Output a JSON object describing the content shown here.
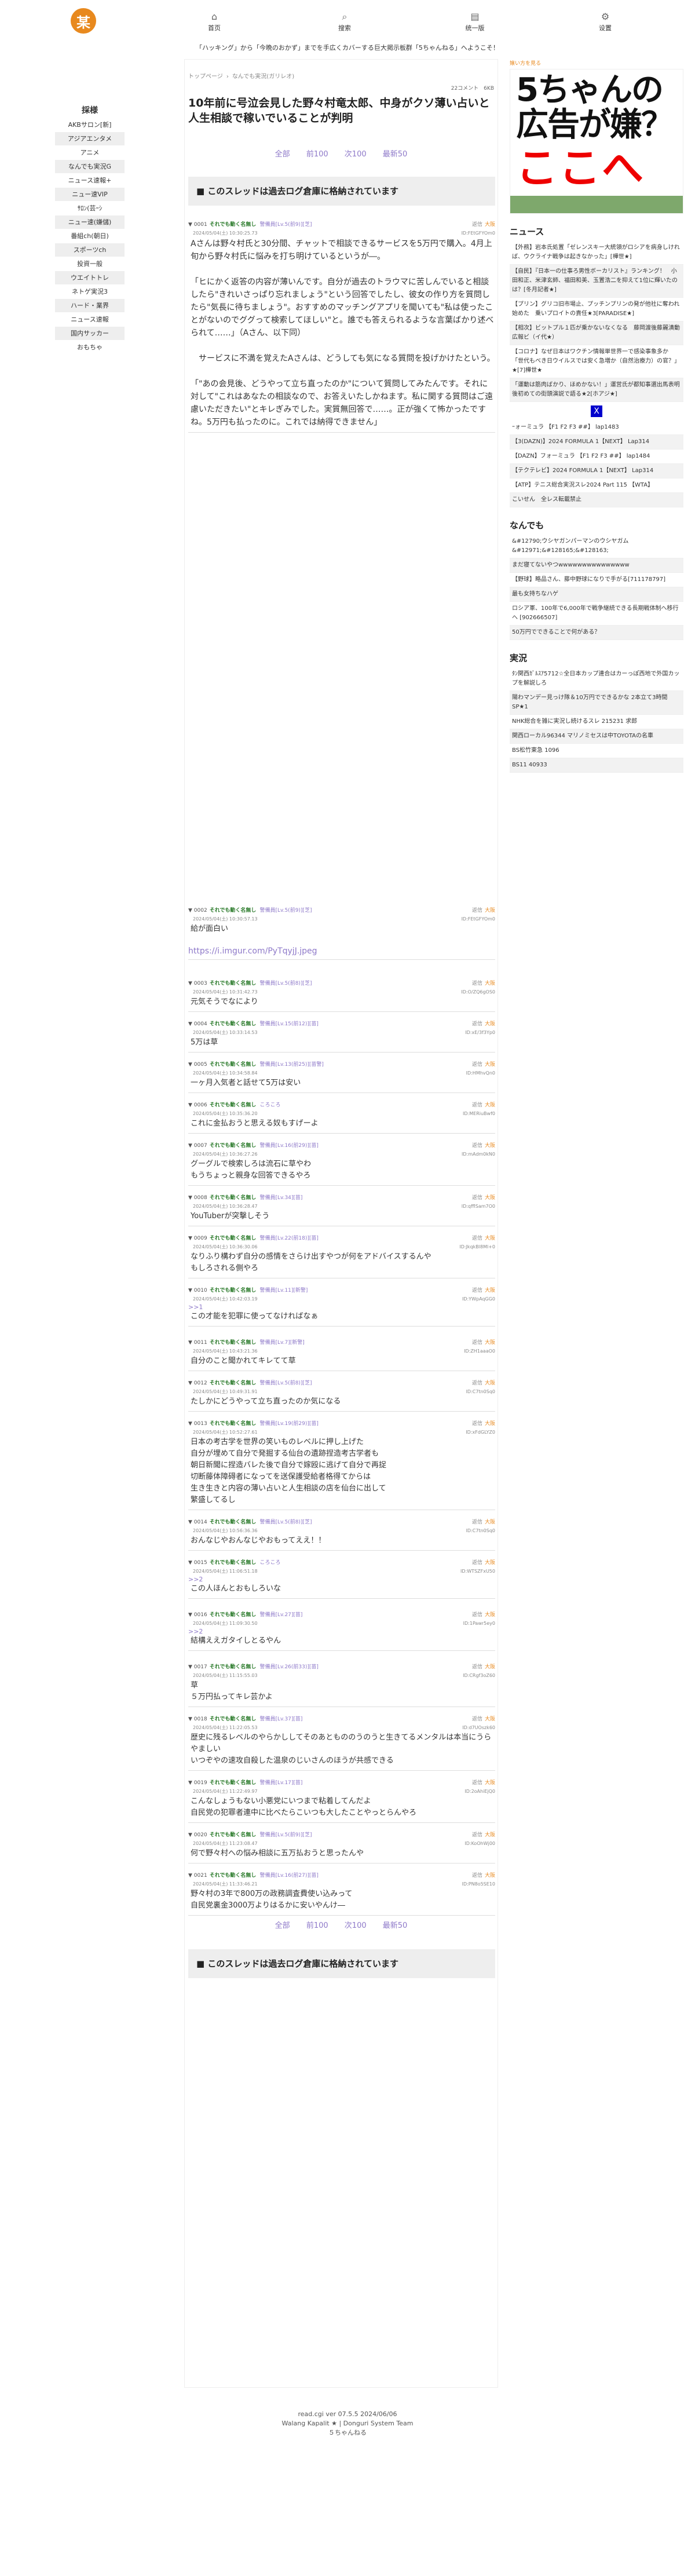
{
  "nav": {
    "logo": "某",
    "items": [
      {
        "label": "首页",
        "icon": "⌂"
      },
      {
        "label": "搜索",
        "icon": "⌕"
      },
      {
        "label": "统一版",
        "icon": "▤"
      },
      {
        "label": "设置",
        "icon": "⚙"
      }
    ]
  },
  "welcome": "「ハッキング」から「今晩のおかず」までを手広くカバーする巨大掲示板群「5ちゃんねる」へようこそ！",
  "sidebar": {
    "title": "採様",
    "items": [
      "AKBサロン[新]",
      "アジアエンタメ",
      "アニメ",
      "なんでも実況G",
      "ニュース速報+",
      "ニュー速VIP",
      "ｻﾛﾝ(芸ｰｼ",
      "ニュー速(嫌儲)",
      "番組ch(朝日)",
      "スポーツch",
      "投資一般",
      "ウエイトトレ",
      "ネトゲ実況3",
      "ハード・業界",
      "ニュース速報",
      "国内サッカー",
      "おもちゃ"
    ]
  },
  "thread": {
    "breadcrumb_home": "トップページ",
    "breadcrumb_sep": "›",
    "breadcrumb_board": "なんでも実況(ガリレオ)",
    "counts": "22コメント　6KB",
    "title": "10年前に号泣会見した野々村竜太郎、中身がクソ薄い占いと人生相談で稼いでいることが判明",
    "pager": [
      "全部",
      "前100",
      "次100",
      "最新50"
    ],
    "archive_notice": "■ このスレッドは過去ログ倉庫に格納されています"
  },
  "posts": [
    {
      "num": "0001",
      "name": "それでも動く名無し",
      "rank": "警備員[Lv.5(前9)][芝]",
      "date": "2024/05/04(土) 10:30:25.73",
      "id": "ID:FEtGFYOm0",
      "os": "大阪",
      "body": "Aさんは野々村氏と30分間、チャットで相談できるサービスを5万円で購入。4月上旬から野々村氏に悩みを打ち明けているというが―。\n\n「ヒにかく返答の内容が薄いんです。自分が過去のトラウマに苦しんでいると相談したら\"きれいさっぱり忘れましょう\"という回答でしたし、彼女の作り方を質問したら\"気長に待ちましょう\"。おすすめのマッチングアプリを聞いても\"私は使ったことがないのでググって検索してほしい\"と。誰でも答えられるような言葉ばかり述べられて……」（Aさん、以下同）\n\n　サービスに不満を覚えたAさんは、どうしても気になる質問を投げかけたという。\n\n「\"あの会見後、どうやって立ち直ったのか\"について質問してみたんです。それに対して\"これはあなたの相談なので、お答えいたしかねます。私に関する質問はご遠慮いただきたい\"とキレぎみでした。実質無回答で……。正が強くて怖かったですね。5万円も払ったのに。これでは納得できません」",
      "big": true
    },
    {
      "num": "0002",
      "name": "それでも動く名無し",
      "rank": "警備員[Lv.5(前9)][芝]",
      "date": "2024/05/04(土) 10:30:57.13",
      "id": "ID:FEtGFYOm0",
      "os": "大阪",
      "body": "給が面白い",
      "link": "https://i.imgur.com/PyTqyjJ.jpeg"
    },
    {
      "num": "0003",
      "name": "それでも動く名無し",
      "rank": "警備員[Lv.5(前8)][芝]",
      "date": "2024/05/04(土) 10:31:42.73",
      "id": "ID:O/ZQ6gOS0",
      "os": "大阪",
      "body": "元気そうでなにより"
    },
    {
      "num": "0004",
      "name": "それでも動く名無し",
      "rank": "警備員[Lv.15(前12)][苗]",
      "date": "2024/05/04(土) 10:33:14.53",
      "id": "ID:xE/3f3Yp0",
      "os": "大阪",
      "body": "5万は草"
    },
    {
      "num": "0005",
      "name": "それでも動く名無し",
      "rank": "警備員[Lv.13(前25)][苗警]",
      "date": "2024/05/04(土) 10:34:58.84",
      "id": "ID:HMhvQn0",
      "os": "大阪",
      "body": "一ヶ月入気者と話せて5万は安い"
    },
    {
      "num": "0006",
      "name": "それでも動く名無し",
      "rank": "ころころ",
      "date": "2024/05/04(土) 10:35:36.20",
      "id": "ID:MERiuBwf0",
      "os": "大阪",
      "body": "これに金払おうと思える奴もすげーよ"
    },
    {
      "num": "0007",
      "name": "それでも動く名無し",
      "rank": "警備員[Lv.16(前29)][苗]",
      "date": "2024/05/04(土) 10:36:27.26",
      "id": "ID:mAdm0kN0",
      "os": "大阪",
      "body": "グーグルで検索しろは流石に草やわ\nもうちょっと親身な回答できるやろ"
    },
    {
      "num": "0008",
      "name": "それでも動く名無し",
      "rank": "警備員[Lv.34][苗]",
      "date": "2024/05/04(土) 10:36:28.47",
      "id": "ID:qfflSam7O0",
      "os": "大阪",
      "body": "YouTuberが突撃しそう"
    },
    {
      "num": "0009",
      "name": "それでも動く名無し",
      "rank": "警備員[Lv.22(前18)][苗]",
      "date": "2024/05/04(土) 10:36:30.06",
      "id": "ID:JkqkBl8Ml+0",
      "os": "大阪",
      "body": "なりふり構わず自分の感情をさらけ出すやつが何をアドバイスするんや\nもしろされる側やろ"
    },
    {
      "num": "0010",
      "name": "それでも動く名無し",
      "rank": "警備員[Lv.11][新警]",
      "date": "2024/05/04(土) 10:42:03.19",
      "id": "ID:YWpAqGG0",
      "os": "大阪",
      "anchor": ">>1",
      "body": "この才能を犯罪に使ってなければなぁ"
    },
    {
      "num": "0011",
      "name": "それでも動く名無し",
      "rank": "警備員[Lv.7][新警]",
      "date": "2024/05/04(土) 10:43:21.36",
      "id": "ID:ZH1aaaO0",
      "os": "大阪",
      "body": "自分のこと聞かれてキレてて草"
    },
    {
      "num": "0012",
      "name": "それでも動く名無し",
      "rank": "警備員[Lv.5(前8)][芝]",
      "date": "2024/05/04(土) 10:49:31.91",
      "id": "ID:C7tn0Sq0",
      "os": "大阪",
      "body": "たしかにどうやって立ち直ったのか気になる"
    },
    {
      "num": "0013",
      "name": "それでも動く名無し",
      "rank": "警備員[Lv.19(前29)][苗]",
      "date": "2024/05/04(土) 10:52:27.61",
      "id": "ID:xFdGLYZ0",
      "os": "大阪",
      "body": "日本の考古学を世界の笑いものレベルに押し上げた\n自分が埋めて自分で発掘する仙台の遺跡捏造考古学者も\n朝日新聞に捏造バレた後で自分で嫁殴に逃げて自分で再捉\n切断藤体障碍者になってを送保護受給者格得てからは\n生き生きと内容の薄い占いと人生相談の店を仙台に出して\n繁盛してるし"
    },
    {
      "num": "0014",
      "name": "それでも動く名無し",
      "rank": "警備員[Lv.5(前8)][芝]",
      "date": "2024/05/04(土) 10:56:36.36",
      "id": "ID:C7tn0Sq0",
      "os": "大阪",
      "body": "おんなじやおんなじやおもってええ！！"
    },
    {
      "num": "0015",
      "name": "それでも動く名無し",
      "rank": "ころころ",
      "date": "2024/05/04(土) 11:06:51.18",
      "id": "ID:WTSZFxU50",
      "os": "大阪",
      "anchor": ">>2",
      "body": "この人ほんとおもしろいな"
    },
    {
      "num": "0016",
      "name": "それでも動く名無し",
      "rank": "警備員[Lv.27][苗]",
      "date": "2024/05/04(土) 11:09:30.50",
      "id": "ID:1Pawr5ey0",
      "os": "大阪",
      "anchor": ">>2",
      "body": "結構ええガタイしとるやん"
    },
    {
      "num": "0017",
      "name": "それでも動く名無し",
      "rank": "警備員[Lv.26(前33)][苗]",
      "date": "2024/05/04(土) 11:15:55.03",
      "id": "ID:CRgf3oZ60",
      "os": "大阪",
      "body": "草\n５万円払ってキレ芸かよ"
    },
    {
      "num": "0018",
      "name": "それでも動く名無し",
      "rank": "警備員[Lv.37][苗]",
      "date": "2024/05/04(土) 11:22:05.53",
      "id": "ID:d7UOszk60",
      "os": "大阪",
      "body": "歴史に残るレベルのやらかししてそのあともののうのうと生きてるメンタルは本当にうらやましい\nいつぞやの速攻自殺した温泉のじいさんのほうが共感できる"
    },
    {
      "num": "0019",
      "name": "それでも動く名無し",
      "rank": "警備員[Lv.17][苗]",
      "date": "2024/05/04(土) 11:22:49.97",
      "id": "ID:2oAhiEjQ0",
      "os": "大阪",
      "body": "こんなしょうもない小悪党にいつまで粘着してんだよ\n自民党の犯罪者連中に比べたらこいつも大したことやっとらんやろ"
    },
    {
      "num": "0020",
      "name": "それでも動く名無し",
      "rank": "警備員[Lv.5(前9)][芝]",
      "date": "2024/05/04(土) 11:23:08.47",
      "id": "ID:KoOhWj00",
      "os": "大阪",
      "body": "何で野々村への悩み相談に五万払おうと思ったんや"
    },
    {
      "num": "0021",
      "name": "それでも動く名無し",
      "rank": "警備員[Lv.16(前27)][苗]",
      "date": "2024/05/04(土) 11:33:46.21",
      "id": "ID:PN8o5SE10",
      "os": "大阪",
      "body": "野々村の3年で800万の政務調査費使い込みって\n自民党裏金3000万よりはるかに安いやんけ―"
    }
  ],
  "right": {
    "ad_label": "嬢い方を見る",
    "ad_line1": "5ちゃんの",
    "ad_line2": "広告が嫌？",
    "ad_line3": "ここへ",
    "news_title": "ニュース",
    "news": [
      "【外務】岩本氏処置「ゼレンスキー大統領がロシアを病身しければ、ウクライナ戦争は起きなかった」[樺世★]",
      "【自民】『日本一の仕事ろ男性ボーカリスト』ランキング！　小田和正、米津玄師、福田和美、玉置浩二を抑えて1位に輝いたのは？[冬月記者★]",
      "【プリン】グリコ旧市場止、プッチンプリンの発が他社に奪われ始めた　乗いプロイトの責任★3[PARADISE★]",
      "【相次】ビットプル１匹が乗かないなくなる　藤岡渡後藤麗潰動広報ビ（イ代★）",
      "【コロナ】なぜ日本はワクチン情報単世界一で感染事象多か　「世代もべき日ウイルスでは安く急増か（自然治療力）の官？」★[7]樺世★",
      "「運動は筋肉ばかり、ほめかない！」運営氏が都知事選出馬表明後初めての街頭演説で語る★2[ホアジ★]"
    ],
    "x_label": "X",
    "f1": [
      "ｰォーミュラ 【F1 F2 F3 ##】 lap1483",
      "【3(DAZN)】2024 FORMULA 1【NEXT】 Lap314",
      "【DAZN】フォーミュラ 【F1 F2 F3 ##】 lap1484",
      "【テクテレビ】2024 FORMULA 1【NEXT】 Lap314",
      "【ATP】テニス総合実況スレ2024 Part 115 【WTA】",
      "こいせん　全レス転載禁止"
    ],
    "nandemo_title": "なんでも",
    "nandemo": [
      "&#12790;ウシヤガンパーマンのウシヤガム&#12971;&#128165;&#128163;",
      "まだ寝てないやつwwwwwwwwwwwwwww",
      "【野球】略品さん、藤中野球になりで手がる[711178797]",
      "最も女持ちなハゲ",
      "ロシア軍、100年で6,000年で戦争継続できる長期戦体制へ移行へ [902666507]",
      "50万円でできることで何がある？"
    ],
    "jikkyo_title": "実況",
    "jikkyo": [
      "ﾀﾝ関西ｶﾞﾙｽｱ5712☆全日本カップ連合はカーっぽ西地で外国カップを解説しろ",
      "陽わマンデー見っけ隊＆10万円でできるかな 2本立て3時間SP★1",
      "NHK総合を雑に実況し続けるスレ 215231 求郎",
      "関西ローカル96344 マリノミセスは中TOYOTAの名車",
      "BS松竹東急 1096",
      "BS11 40933"
    ]
  },
  "footer": {
    "line1": "read.cgi ver 07.5.5 2024/06/06",
    "line2": "Walang Kapalit ★ | Donguri System Team",
    "line3": "５ちゃんねる"
  }
}
